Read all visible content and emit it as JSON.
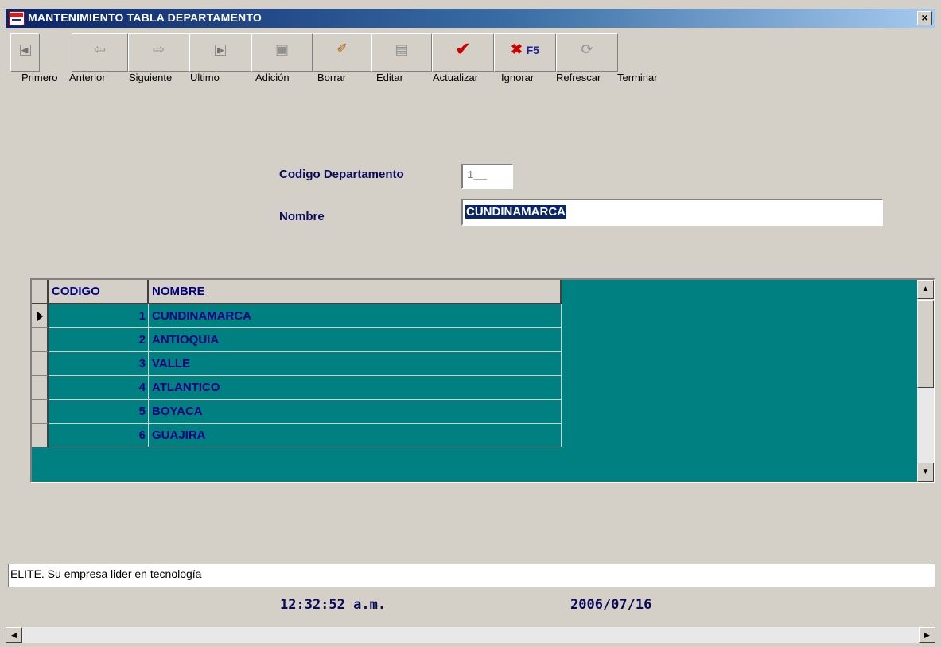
{
  "window": {
    "title": "MANTENIMIENTO TABLA DEPARTAMENTO",
    "close_label": "×"
  },
  "toolbar": {
    "buttons": [
      {
        "label": "Primero",
        "icon": "first-record-icon",
        "glyph": "⏮"
      },
      {
        "label": "Anterior",
        "icon": "arrow-left-icon",
        "glyph": "⇦"
      },
      {
        "label": "Siguiente",
        "icon": "arrow-right-icon",
        "glyph": "⇨"
      },
      {
        "label": "Ultimo",
        "icon": "last-record-icon",
        "glyph": "⏭"
      },
      {
        "label": "Adición",
        "icon": "save-disk-icon",
        "glyph": "🖫"
      },
      {
        "label": "Borrar",
        "icon": "eraser-icon",
        "glyph": "✐"
      },
      {
        "label": "Editar",
        "icon": "edit-document-icon",
        "glyph": "📄"
      },
      {
        "label": "Actualizar",
        "icon": "check-icon",
        "glyph": "✔"
      },
      {
        "label": "Ignorar",
        "icon": "cancel-x-icon",
        "glyph": "✖",
        "extra": "F5"
      },
      {
        "label": "Refrescar",
        "icon": "refresh-icon",
        "glyph": "⟳"
      },
      {
        "label": "Terminar",
        "icon": "",
        "glyph": ""
      }
    ]
  },
  "form": {
    "codigo_label": "Codigo Departamento",
    "codigo_value": "1__",
    "nombre_label": "Nombre",
    "nombre_value": "CUNDINAMARCA"
  },
  "grid": {
    "columns": [
      "CODIGO",
      "NOMBRE"
    ],
    "rows": [
      {
        "codigo": "1",
        "nombre": "CUNDINAMARCA"
      },
      {
        "codigo": "2",
        "nombre": "ANTIOQUIA"
      },
      {
        "codigo": "3",
        "nombre": "VALLE"
      },
      {
        "codigo": "4",
        "nombre": "ATLANTICO"
      },
      {
        "codigo": "5",
        "nombre": "BOYACA"
      },
      {
        "codigo": "6",
        "nombre": "GUAJIRA"
      }
    ],
    "current_row": 0
  },
  "status": {
    "message": "ELITE. Su empresa lider en tecnología",
    "time": "12:32:52 a.m.",
    "date": "2006/07/16"
  },
  "colors": {
    "grid_background": "#008080",
    "title_bar": "#0a246a",
    "grid_text": "#000080"
  }
}
